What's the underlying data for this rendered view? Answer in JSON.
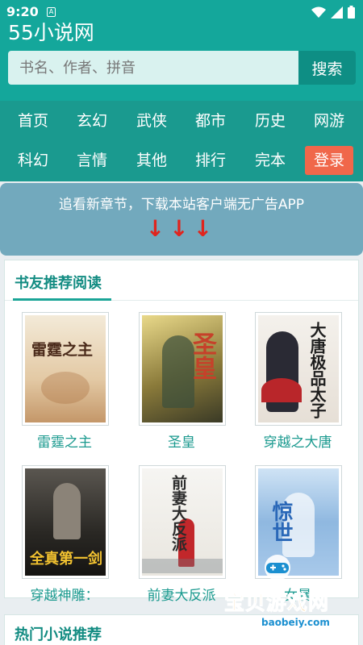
{
  "status_bar": {
    "time": "9:20",
    "notif_letter": "A"
  },
  "header": {
    "site_title": "55小说网",
    "search": {
      "placeholder": "书名、作者、拼音",
      "value": "",
      "button_label": "搜索"
    }
  },
  "nav": {
    "items": [
      "首页",
      "玄幻",
      "武侠",
      "都市",
      "历史",
      "网游",
      "科幻",
      "言情",
      "其他",
      "排行",
      "完本",
      "登录"
    ]
  },
  "banner": {
    "text": "追看新章节，下载本站客户端无广告APP",
    "arrows": "↓↓↓"
  },
  "recommend": {
    "title": "书友推荐阅读",
    "books": [
      {
        "title": "雷霆之主",
        "cover_text": "雷霆之主"
      },
      {
        "title": "圣皇",
        "cover_text": "圣皇"
      },
      {
        "title": "穿越之大唐",
        "cover_text": "大唐极品太子"
      },
      {
        "title": "穿越神雕：",
        "cover_text": "全真第一剑"
      },
      {
        "title": "前妻大反派",
        "cover_text": "前妻大反派"
      },
      {
        "title": "女暴",
        "cover_text": "惊世"
      }
    ]
  },
  "hot": {
    "title": "热门小说推荐"
  },
  "watermark": {
    "text": "宝贝游戏网",
    "url": "baobeiy.com"
  },
  "colors": {
    "primary": "#14a79b",
    "nav": "#1a9a8f",
    "login": "#f0674a",
    "banner": "#72a9bd",
    "accent_text": "#1b9a8f"
  }
}
